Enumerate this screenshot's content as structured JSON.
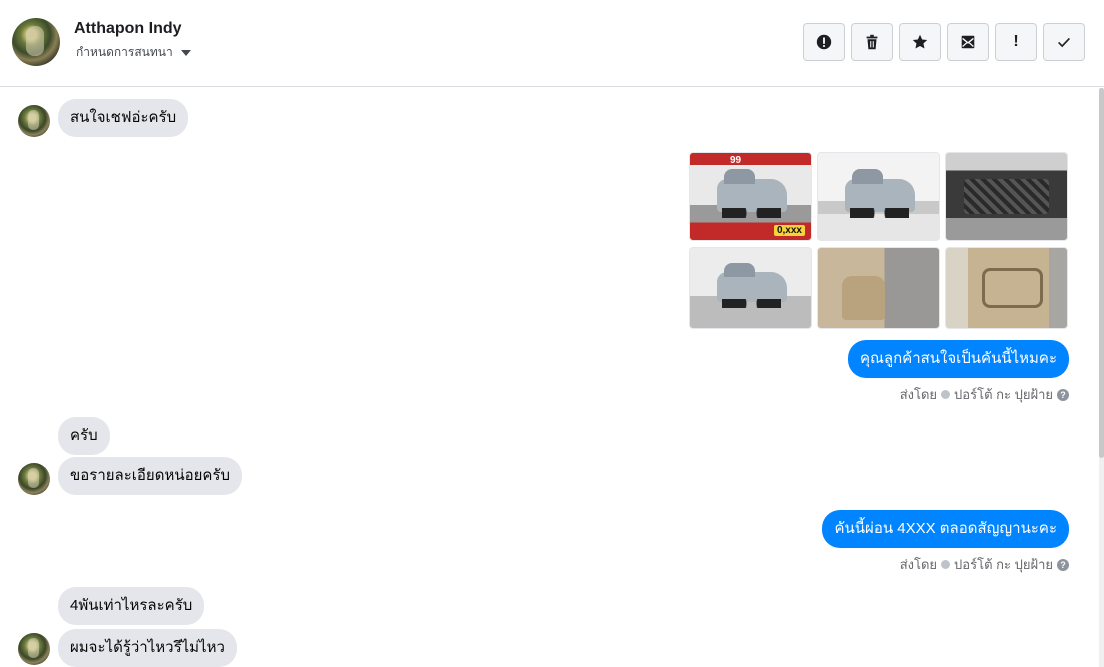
{
  "header": {
    "name": "Atthapon Indy",
    "assign_label": "กำหนดการสนทนา",
    "toolbar": [
      {
        "icon": "alert-circle-icon",
        "glyph": "!"
      },
      {
        "icon": "trash-icon",
        "glyph": ""
      },
      {
        "icon": "star-icon",
        "glyph": "★"
      },
      {
        "icon": "mark-unread-icon",
        "glyph": ""
      },
      {
        "icon": "exclamation-icon",
        "glyph": "!"
      },
      {
        "icon": "check-icon",
        "glyph": "✓"
      }
    ]
  },
  "messages": {
    "m1": "สนใจเชฟอ่ะครับ",
    "photos_price": "0,xxx",
    "photos_badge": "99",
    "m2": "คุณลูกค้าสนใจเป็นคันนี้ไหมคะ",
    "sent_by_prefix": "ส่งโดย",
    "sent_by_name": "ปอร์โต้ กะ ปุยฝ้าย",
    "m3": "ครับ",
    "m4": "ขอรายละเอียดหน่อยครับ",
    "m5": "คันนี้ผ่อน 4XXX ตลอดสัญญานะคะ",
    "m6": "4พันเท่าไหรละครับ",
    "m7": "ผมจะได้รู้ว่าไหวรึไม่ไหว"
  },
  "colors": {
    "outgoing_bubble": "#0084ff",
    "incoming_bubble": "#e4e6eb"
  }
}
